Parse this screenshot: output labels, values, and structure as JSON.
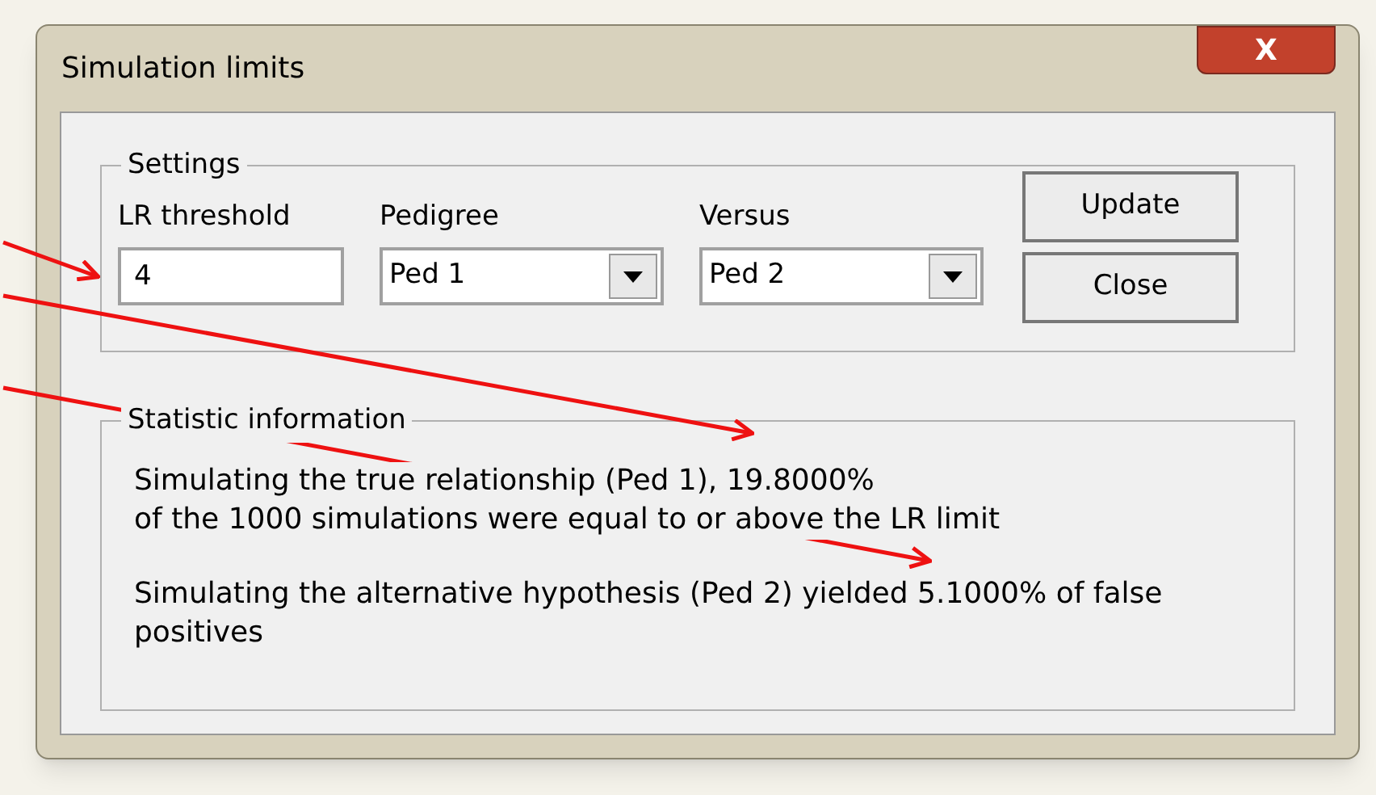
{
  "window": {
    "title": "Simulation limits",
    "close_label": "X"
  },
  "settings": {
    "title": "Settings",
    "fields": [
      {
        "kind": "text",
        "label": "LR threshold",
        "value": "4"
      },
      {
        "kind": "dropdown",
        "label": "Pedigree",
        "value": "Ped 1"
      },
      {
        "kind": "dropdown",
        "label": "Versus",
        "value": "Ped 2"
      }
    ],
    "buttons": [
      "Update",
      "Close"
    ]
  },
  "statistics": {
    "title": "Statistic information",
    "paragraphs": [
      [
        "Simulating the true relationship (Ped 1), 19.8000%",
        "of the 1000 simulations were equal to or above the LR limit"
      ],
      [
        "Simulating the alternative hypothesis (Ped 2) yielded 5.1000% of false",
        "positives"
      ]
    ]
  }
}
